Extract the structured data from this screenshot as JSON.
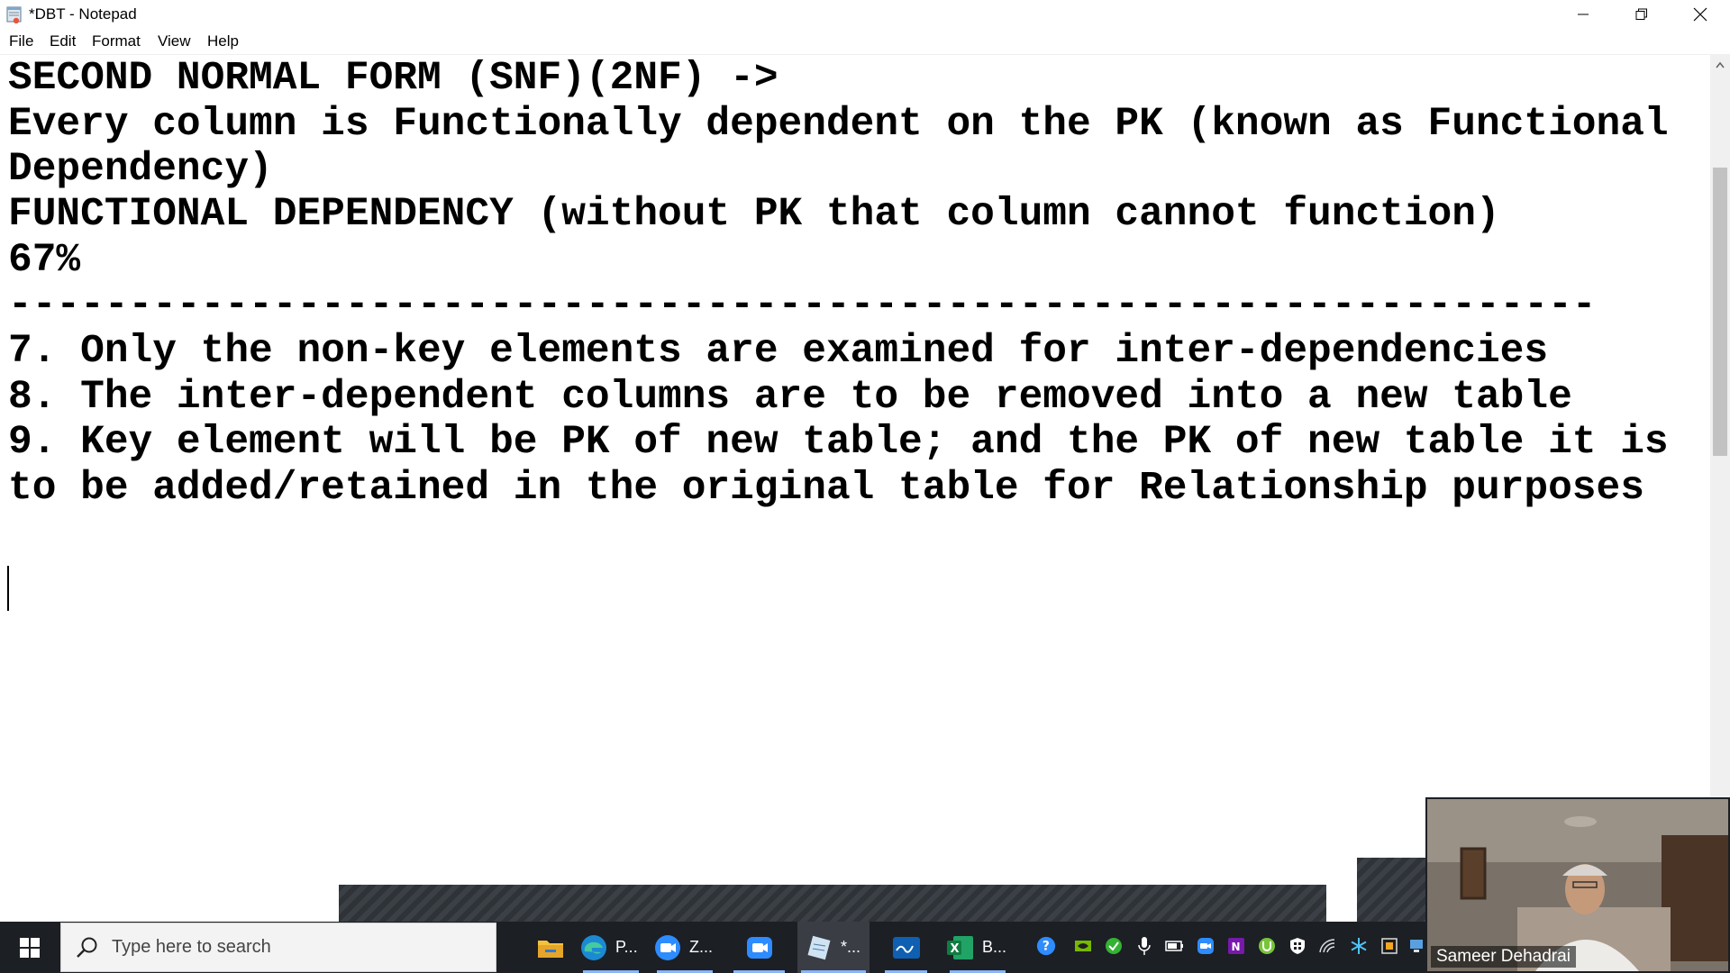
{
  "window": {
    "title": "*DBT - Notepad",
    "minimize_icon": "minimize-icon",
    "maximize_icon": "restore-icon",
    "close_icon": "close-icon"
  },
  "menu": {
    "file": "File",
    "edit": "Edit",
    "format": "Format",
    "view": "View",
    "help": "Help"
  },
  "editor": {
    "lines": [
      "SECOND NORMAL FORM (SNF)(2NF) ->",
      "Every column is Functionally dependent on the PK (known as Functional",
      "Dependency)",
      "FUNCTIONAL DEPENDENCY (without PK that column cannot function)",
      "67%",
      "------------------------------------------------------------------",
      "7. Only the non-key elements are examined for inter-dependencies",
      "8. The inter-dependent columns are to be removed into a new table",
      "9. Key element will be PK of new table; and the PK of new table it is",
      "to be added/retained in the original table for Relationship purposes"
    ]
  },
  "taskbar": {
    "search_placeholder": "Type here to search",
    "apps": [
      {
        "icon": "file-explorer-icon",
        "label": ""
      },
      {
        "icon": "edge-icon",
        "label": "P..."
      },
      {
        "icon": "zoom-icon",
        "label": "Z..."
      },
      {
        "icon": "zoom-meeting-icon",
        "label": ""
      },
      {
        "icon": "notepad-icon",
        "label": "*..."
      },
      {
        "icon": "whiteboard-icon",
        "label": ""
      },
      {
        "icon": "excel-icon",
        "label": "B..."
      }
    ]
  },
  "webcam": {
    "participant_name": "Sameer Dehadrai"
  },
  "colors": {
    "taskbar_bg": "#1c1f24",
    "editor_bg": "#ffffff",
    "text": "#000000",
    "active_indicator": "#8ab4f8"
  }
}
